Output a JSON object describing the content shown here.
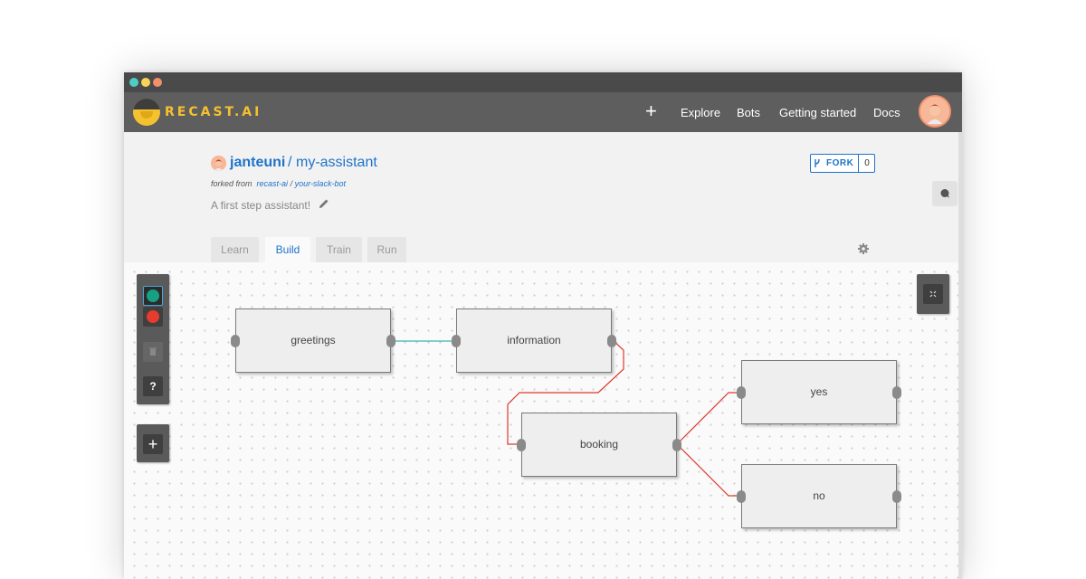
{
  "window": {
    "title_dots": [
      "close",
      "minimize",
      "maximize"
    ]
  },
  "appbar": {
    "logo_text": "RECAST.AI",
    "plus_label": "+",
    "nav": [
      "Explore",
      "Bots",
      "Getting started",
      "Docs"
    ]
  },
  "repo": {
    "owner": "janteuni",
    "separator": "/",
    "name": "my-assistant",
    "forked_prefix": "forked from",
    "forked_owner": "recast-ai",
    "forked_sep": "/",
    "forked_repo": "your-slack-bot",
    "description": "A first step assistant!"
  },
  "fork": {
    "label": "FORK",
    "count": "0"
  },
  "tabs": [
    {
      "label": "Learn",
      "active": false
    },
    {
      "label": "Build",
      "active": true
    },
    {
      "label": "Train",
      "active": false
    },
    {
      "label": "Run",
      "active": false
    }
  ],
  "toolbar": {
    "help_label": "?",
    "add_label": "+"
  },
  "flow": {
    "nodes": [
      "greetings",
      "information",
      "booking",
      "yes",
      "no"
    ],
    "edges": [
      {
        "from": "greetings",
        "to": "information",
        "color": "#3ab5b0"
      },
      {
        "from": "information",
        "to": "booking",
        "color": "#d93a2b"
      },
      {
        "from": "booking",
        "to": "yes",
        "color": "#d93a2b"
      },
      {
        "from": "booking",
        "to": "no",
        "color": "#d93a2b"
      }
    ]
  },
  "colors": {
    "accent": "#1d73c9",
    "brand": "#f5c12e",
    "appbar": "#5e5e5e",
    "teal": "#16a085",
    "red": "#e53c2e"
  }
}
